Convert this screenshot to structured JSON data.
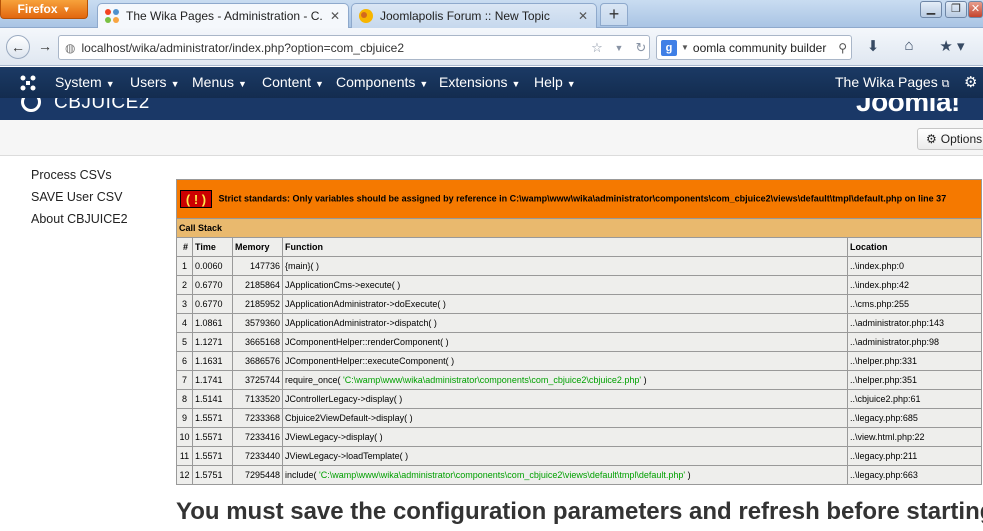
{
  "browser": {
    "menu_button": "Firefox",
    "tabs": [
      {
        "label": "The Wika Pages - Administration - C...",
        "active": true,
        "icon": "joomla-favicon"
      },
      {
        "label": "Joomlapolis Forum :: New Topic",
        "active": false,
        "icon": "joomlapolis-favicon"
      }
    ],
    "new_tab_label": "+",
    "url": "localhost/wika/administrator/index.php?option=com_cbjuice2",
    "search_text": "oomla community builder"
  },
  "admin": {
    "menus": [
      {
        "label": "System"
      },
      {
        "label": "Users"
      },
      {
        "label": "Menus"
      },
      {
        "label": "Content"
      },
      {
        "label": "Components"
      },
      {
        "label": "Extensions"
      },
      {
        "label": "Help"
      }
    ],
    "site_link": "The Wika Pages",
    "component_title": "CBJUICE2",
    "brand": "Joomla!",
    "options_button": "Options"
  },
  "sidebar": {
    "items": [
      {
        "label": "Process CSVs"
      },
      {
        "label": "SAVE User CSV"
      },
      {
        "label": "About CBJUICE2"
      }
    ]
  },
  "error": {
    "badge": "( ! )",
    "message": "Strict standards: Only variables should be assigned by reference in C:\\wamp\\www\\wika\\administrator\\components\\com_cbjuice2\\views\\default\\tmpl\\default.php on line 37",
    "call_stack_label": "Call Stack",
    "columns": [
      "#",
      "Time",
      "Memory",
      "Function",
      "Location"
    ],
    "rows": [
      {
        "n": "1",
        "time": "0.0060",
        "mem": "147736",
        "func": "{main}( )",
        "arg": "",
        "loc": "..\\index.php:0"
      },
      {
        "n": "2",
        "time": "0.6770",
        "mem": "2185864",
        "func": "JApplicationCms->execute( )",
        "arg": "",
        "loc": "..\\index.php:42"
      },
      {
        "n": "3",
        "time": "0.6770",
        "mem": "2185952",
        "func": "JApplicationAdministrator->doExecute( )",
        "arg": "",
        "loc": "..\\cms.php:255"
      },
      {
        "n": "4",
        "time": "1.0861",
        "mem": "3579360",
        "func": "JApplicationAdministrator->dispatch( )",
        "arg": "",
        "loc": "..\\administrator.php:143"
      },
      {
        "n": "5",
        "time": "1.1271",
        "mem": "3665168",
        "func": "JComponentHelper::renderComponent( )",
        "arg": "",
        "loc": "..\\administrator.php:98"
      },
      {
        "n": "6",
        "time": "1.1631",
        "mem": "3686576",
        "func": "JComponentHelper::executeComponent( )",
        "arg": "",
        "loc": "..\\helper.php:331"
      },
      {
        "n": "7",
        "time": "1.1741",
        "mem": "3725744",
        "func": "require_once( ",
        "arg": "'C:\\wamp\\www\\wika\\administrator\\components\\com_cbjuice2\\cbjuice2.php'",
        "loc": "..\\helper.php:351"
      },
      {
        "n": "8",
        "time": "1.5141",
        "mem": "7133520",
        "func": "JControllerLegacy->display( )",
        "arg": "",
        "loc": "..\\cbjuice2.php:61"
      },
      {
        "n": "9",
        "time": "1.5571",
        "mem": "7233368",
        "func": "Cbjuice2ViewDefault->display( )",
        "arg": "",
        "loc": "..\\legacy.php:685"
      },
      {
        "n": "10",
        "time": "1.5571",
        "mem": "7233416",
        "func": "JViewLegacy->display( )",
        "arg": "",
        "loc": "..\\view.html.php:22"
      },
      {
        "n": "11",
        "time": "1.5571",
        "mem": "7233440",
        "func": "JViewLegacy->loadTemplate( )",
        "arg": "",
        "loc": "..\\legacy.php:211"
      },
      {
        "n": "12",
        "time": "1.5751",
        "mem": "7295448",
        "func": "include( ",
        "arg": "'C:\\wamp\\www\\wika\\administrator\\components\\com_cbjuice2\\views\\default\\tmpl\\default.php'",
        "loc": "..\\legacy.php:663"
      }
    ]
  },
  "notice": "You must save the configuration parameters and refresh before starting",
  "colors": {
    "adminbar": "#1b3a65",
    "error_bg": "#f57900",
    "callstack_bg": "#e9b96e",
    "path_green": "#00a000"
  }
}
